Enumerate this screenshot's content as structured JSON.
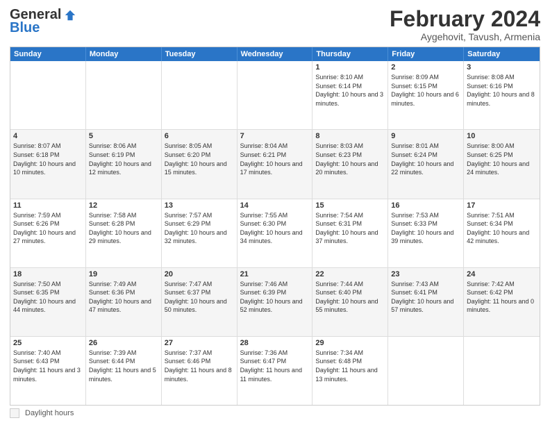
{
  "header": {
    "logo_general": "General",
    "logo_blue": "Blue",
    "month_title": "February 2024",
    "subtitle": "Aygehovit, Tavush, Armenia"
  },
  "days_of_week": [
    "Sunday",
    "Monday",
    "Tuesday",
    "Wednesday",
    "Thursday",
    "Friday",
    "Saturday"
  ],
  "legend": {
    "label": "Daylight hours"
  },
  "rows": [
    {
      "shade": false,
      "cells": [
        {
          "day": "",
          "info": ""
        },
        {
          "day": "",
          "info": ""
        },
        {
          "day": "",
          "info": ""
        },
        {
          "day": "",
          "info": ""
        },
        {
          "day": "1",
          "info": "Sunrise: 8:10 AM\nSunset: 6:14 PM\nDaylight: 10 hours\nand 3 minutes."
        },
        {
          "day": "2",
          "info": "Sunrise: 8:09 AM\nSunset: 6:15 PM\nDaylight: 10 hours\nand 6 minutes."
        },
        {
          "day": "3",
          "info": "Sunrise: 8:08 AM\nSunset: 6:16 PM\nDaylight: 10 hours\nand 8 minutes."
        }
      ]
    },
    {
      "shade": true,
      "cells": [
        {
          "day": "4",
          "info": "Sunrise: 8:07 AM\nSunset: 6:18 PM\nDaylight: 10 hours\nand 10 minutes."
        },
        {
          "day": "5",
          "info": "Sunrise: 8:06 AM\nSunset: 6:19 PM\nDaylight: 10 hours\nand 12 minutes."
        },
        {
          "day": "6",
          "info": "Sunrise: 8:05 AM\nSunset: 6:20 PM\nDaylight: 10 hours\nand 15 minutes."
        },
        {
          "day": "7",
          "info": "Sunrise: 8:04 AM\nSunset: 6:21 PM\nDaylight: 10 hours\nand 17 minutes."
        },
        {
          "day": "8",
          "info": "Sunrise: 8:03 AM\nSunset: 6:23 PM\nDaylight: 10 hours\nand 20 minutes."
        },
        {
          "day": "9",
          "info": "Sunrise: 8:01 AM\nSunset: 6:24 PM\nDaylight: 10 hours\nand 22 minutes."
        },
        {
          "day": "10",
          "info": "Sunrise: 8:00 AM\nSunset: 6:25 PM\nDaylight: 10 hours\nand 24 minutes."
        }
      ]
    },
    {
      "shade": false,
      "cells": [
        {
          "day": "11",
          "info": "Sunrise: 7:59 AM\nSunset: 6:26 PM\nDaylight: 10 hours\nand 27 minutes."
        },
        {
          "day": "12",
          "info": "Sunrise: 7:58 AM\nSunset: 6:28 PM\nDaylight: 10 hours\nand 29 minutes."
        },
        {
          "day": "13",
          "info": "Sunrise: 7:57 AM\nSunset: 6:29 PM\nDaylight: 10 hours\nand 32 minutes."
        },
        {
          "day": "14",
          "info": "Sunrise: 7:55 AM\nSunset: 6:30 PM\nDaylight: 10 hours\nand 34 minutes."
        },
        {
          "day": "15",
          "info": "Sunrise: 7:54 AM\nSunset: 6:31 PM\nDaylight: 10 hours\nand 37 minutes."
        },
        {
          "day": "16",
          "info": "Sunrise: 7:53 AM\nSunset: 6:33 PM\nDaylight: 10 hours\nand 39 minutes."
        },
        {
          "day": "17",
          "info": "Sunrise: 7:51 AM\nSunset: 6:34 PM\nDaylight: 10 hours\nand 42 minutes."
        }
      ]
    },
    {
      "shade": true,
      "cells": [
        {
          "day": "18",
          "info": "Sunrise: 7:50 AM\nSunset: 6:35 PM\nDaylight: 10 hours\nand 44 minutes."
        },
        {
          "day": "19",
          "info": "Sunrise: 7:49 AM\nSunset: 6:36 PM\nDaylight: 10 hours\nand 47 minutes."
        },
        {
          "day": "20",
          "info": "Sunrise: 7:47 AM\nSunset: 6:37 PM\nDaylight: 10 hours\nand 50 minutes."
        },
        {
          "day": "21",
          "info": "Sunrise: 7:46 AM\nSunset: 6:39 PM\nDaylight: 10 hours\nand 52 minutes."
        },
        {
          "day": "22",
          "info": "Sunrise: 7:44 AM\nSunset: 6:40 PM\nDaylight: 10 hours\nand 55 minutes."
        },
        {
          "day": "23",
          "info": "Sunrise: 7:43 AM\nSunset: 6:41 PM\nDaylight: 10 hours\nand 57 minutes."
        },
        {
          "day": "24",
          "info": "Sunrise: 7:42 AM\nSunset: 6:42 PM\nDaylight: 11 hours\nand 0 minutes."
        }
      ]
    },
    {
      "shade": false,
      "cells": [
        {
          "day": "25",
          "info": "Sunrise: 7:40 AM\nSunset: 6:43 PM\nDaylight: 11 hours\nand 3 minutes."
        },
        {
          "day": "26",
          "info": "Sunrise: 7:39 AM\nSunset: 6:44 PM\nDaylight: 11 hours\nand 5 minutes."
        },
        {
          "day": "27",
          "info": "Sunrise: 7:37 AM\nSunset: 6:46 PM\nDaylight: 11 hours\nand 8 minutes."
        },
        {
          "day": "28",
          "info": "Sunrise: 7:36 AM\nSunset: 6:47 PM\nDaylight: 11 hours\nand 11 minutes."
        },
        {
          "day": "29",
          "info": "Sunrise: 7:34 AM\nSunset: 6:48 PM\nDaylight: 11 hours\nand 13 minutes."
        },
        {
          "day": "",
          "info": ""
        },
        {
          "day": "",
          "info": ""
        }
      ]
    }
  ]
}
